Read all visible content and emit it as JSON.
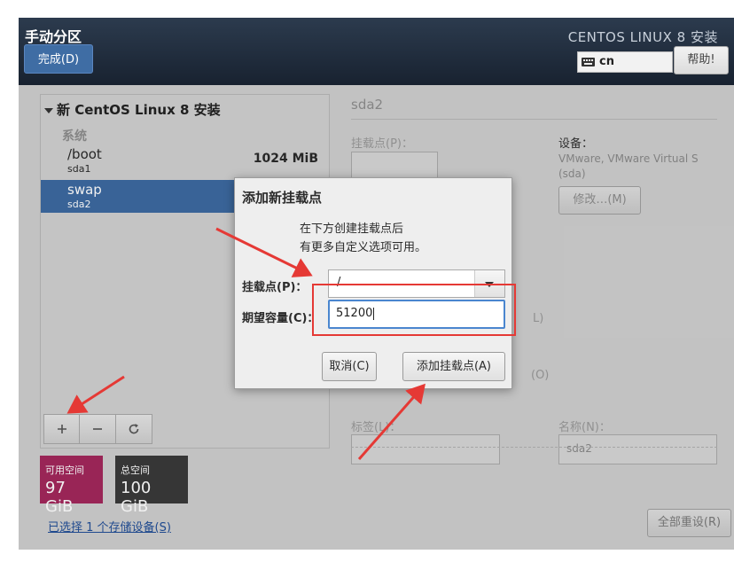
{
  "header": {
    "title": "手动分区",
    "done_button": "完成(D)",
    "install_title": "CENTOS LINUX 8 安装",
    "keyboard_layout": "cn",
    "help_button": "帮助!"
  },
  "left_panel": {
    "new_install_heading": "新 CentOS Linux 8 安装",
    "system_label": "系统",
    "mount_points": [
      {
        "name": "/boot",
        "device": "sda1",
        "size": "1024 MiB",
        "selected": false
      },
      {
        "name": "swap",
        "device": "sda2",
        "size": "",
        "selected": true
      }
    ],
    "toolbar": {
      "add_icon": "plus-icon",
      "remove_icon": "minus-icon",
      "refresh_icon": "refresh-icon"
    },
    "available_space": {
      "label": "可用空间",
      "value": "97 GiB"
    },
    "total_space": {
      "label": "总空间",
      "value": "100 GiB"
    },
    "storage_link": "已选择 1 个存储设备(S)"
  },
  "right_panel": {
    "title": "sda2",
    "mount_point_label": "挂载点(P)：",
    "device_label": "设备：",
    "device_text": "VMware, VMware Virtual S (sda)",
    "modify_button": "修改…(M)",
    "partial_1": "L)",
    "partial_2": "(O)",
    "label_label": "标签(L)：",
    "name_label": "名称(N)：",
    "name_value": "sda2",
    "reset_button": "全部重设(R)"
  },
  "dialog": {
    "title": "添加新挂载点",
    "description_line1": "在下方创建挂载点后",
    "description_line2": "有更多自定义选项可用。",
    "mount_point_label": "挂载点(P)：",
    "mount_point_value": "/",
    "capacity_label": "期望容量(C)：",
    "capacity_value": "51200",
    "cancel_button": "取消(C)",
    "add_button": "添加挂载点(A)"
  },
  "colors": {
    "selection": "#3d6aa1",
    "available_space": "#a3285c",
    "annotation_red": "#e53935"
  }
}
